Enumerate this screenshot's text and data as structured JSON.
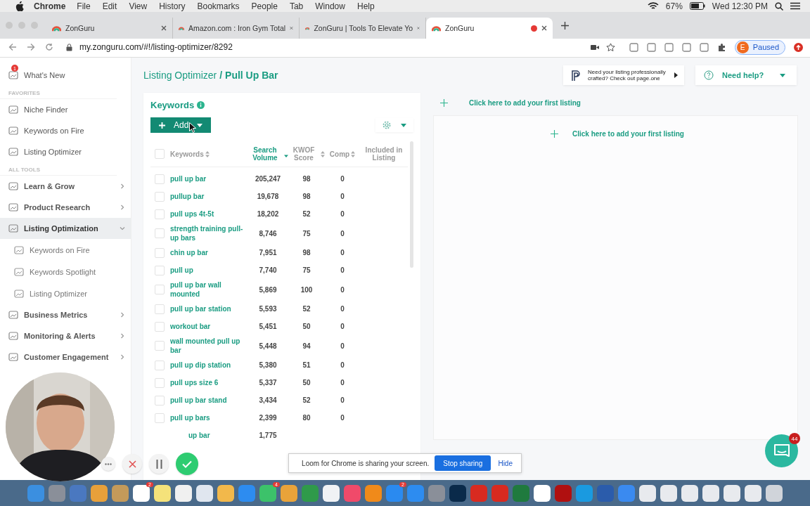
{
  "menu_bar": {
    "app": "Chrome",
    "menus": [
      "File",
      "Edit",
      "View",
      "History",
      "Bookmarks",
      "People",
      "Tab",
      "Window",
      "Help"
    ],
    "battery": "67%",
    "clock": "Wed 12:30 PM"
  },
  "browser_tabs": [
    {
      "title": "ZonGuru",
      "selected": false,
      "recording": false
    },
    {
      "title": "Amazon.com : Iron Gym Total",
      "selected": false,
      "recording": false
    },
    {
      "title": "ZonGuru | Tools To Elevate Yo",
      "selected": false,
      "recording": false
    },
    {
      "title": "ZonGuru",
      "selected": true,
      "recording": true
    }
  ],
  "address_bar": {
    "url": "my.zonguru.com/#!/listing-optimizer/8292",
    "profile_initial": "E",
    "profile_status": "Paused"
  },
  "sidebar": {
    "items": [
      {
        "kind": "item",
        "label": "What's New",
        "badge": "1",
        "selected": false
      },
      {
        "kind": "section",
        "label": "FAVORITES"
      },
      {
        "kind": "item",
        "label": "Niche Finder",
        "selected": false
      },
      {
        "kind": "item",
        "label": "Keywords on Fire",
        "selected": false
      },
      {
        "kind": "item",
        "label": "Listing Optimizer",
        "selected": false
      },
      {
        "kind": "section",
        "label": "ALL TOOLS"
      },
      {
        "kind": "group",
        "label": "Learn & Grow",
        "expanded": false,
        "selected": false
      },
      {
        "kind": "group",
        "label": "Product Research",
        "expanded": false,
        "selected": false
      },
      {
        "kind": "group",
        "label": "Listing Optimization",
        "expanded": true,
        "selected": true,
        "children": [
          {
            "label": "Keywords on Fire",
            "selected": false
          },
          {
            "label": "Keywords Spotlight",
            "selected": false
          },
          {
            "label": "Listing Optimizer",
            "selected": false
          }
        ]
      },
      {
        "kind": "group",
        "label": "Business Metrics",
        "expanded": false,
        "selected": false
      },
      {
        "kind": "group",
        "label": "Monitoring & Alerts",
        "expanded": false,
        "selected": false
      },
      {
        "kind": "group",
        "label": "Customer Engagement",
        "expanded": false,
        "selected": false
      }
    ]
  },
  "breadcrumb": {
    "parent": "Listing Optimizer",
    "separator": "/",
    "current": "Pull Up Bar"
  },
  "promo": {
    "text": "Need your listing professionally crafted? Check out page.one"
  },
  "help": {
    "label": "Need help?"
  },
  "keywords": {
    "title": "Keywords",
    "add_button": "Add",
    "select_all": {
      "checked": false
    },
    "columns": [
      {
        "label": "Keywords",
        "sortable": true,
        "sorted": false
      },
      {
        "label": "Search Volume",
        "sortable": true,
        "sorted": true
      },
      {
        "label": "KWOF Score",
        "sortable": true,
        "sorted": false
      },
      {
        "label": "Comp",
        "sortable": true,
        "sorted": false
      },
      {
        "label": "Included in Listing",
        "sortable": false,
        "sorted": false
      }
    ],
    "rows": [
      {
        "keyword": "pull up bar",
        "volume": "205,247",
        "kwof": "98",
        "comp": "0",
        "checked": false
      },
      {
        "keyword": "pullup bar",
        "volume": "19,678",
        "kwof": "98",
        "comp": "0",
        "checked": false
      },
      {
        "keyword": "pull ups 4t-5t",
        "volume": "18,202",
        "kwof": "52",
        "comp": "0",
        "checked": false
      },
      {
        "keyword": "strength training pull-up bars",
        "volume": "8,746",
        "kwof": "75",
        "comp": "0",
        "checked": false
      },
      {
        "keyword": "chin up bar",
        "volume": "7,951",
        "kwof": "98",
        "comp": "0",
        "checked": false
      },
      {
        "keyword": "pull up",
        "volume": "7,740",
        "kwof": "75",
        "comp": "0",
        "checked": false
      },
      {
        "keyword": "pull up bar wall mounted",
        "volume": "5,869",
        "kwof": "100",
        "comp": "0",
        "checked": false
      },
      {
        "keyword": "pull up bar station",
        "volume": "5,593",
        "kwof": "52",
        "comp": "0",
        "checked": false
      },
      {
        "keyword": "workout bar",
        "volume": "5,451",
        "kwof": "50",
        "comp": "0",
        "checked": false
      },
      {
        "keyword": "wall mounted pull up bar",
        "volume": "5,448",
        "kwof": "94",
        "comp": "0",
        "checked": false
      },
      {
        "keyword": "pull up dip station",
        "volume": "5,380",
        "kwof": "51",
        "comp": "0",
        "checked": false
      },
      {
        "keyword": "pull ups size 6",
        "volume": "5,337",
        "kwof": "50",
        "comp": "0",
        "checked": false
      },
      {
        "keyword": "pull up bar stand",
        "volume": "3,434",
        "kwof": "52",
        "comp": "0",
        "checked": false
      },
      {
        "keyword": "pull up bars",
        "volume": "2,399",
        "kwof": "80",
        "comp": "0",
        "checked": false
      },
      {
        "keyword": "up bar",
        "volume": "1,775"
      }
    ]
  },
  "listing": {
    "add_link": "Click here to add your first listing",
    "card_add_link": "Click here to add your first listing"
  },
  "loom": {
    "message": "Loom for Chrome is sharing your screen.",
    "stop": "Stop sharing",
    "hide": "Hide"
  },
  "chat": {
    "badge": "44"
  },
  "dock": [
    {
      "color": "#3b8fe0"
    },
    {
      "color": "#8a8f99"
    },
    {
      "color": "#4a78c0"
    },
    {
      "color": "#e8a03a"
    },
    {
      "color": "#c49a5a"
    },
    {
      "color": "#ffffff",
      "badge": "2"
    },
    {
      "color": "#f5e27a"
    },
    {
      "color": "#f0f0f0"
    },
    {
      "color": "#e0e6ef"
    },
    {
      "color": "#f2b84b"
    },
    {
      "color": "#2d8cf0"
    },
    {
      "color": "#3cc26a",
      "badge": "4"
    },
    {
      "color": "#e9a33a"
    },
    {
      "color": "#2f9a4a"
    },
    {
      "color": "#f0f2f5"
    },
    {
      "color": "#f04a6a"
    },
    {
      "color": "#f08a1a"
    },
    {
      "color": "#2a8af0",
      "badge": "2"
    },
    {
      "color": "#2d8cf0"
    },
    {
      "color": "#8a8f99"
    },
    {
      "color": "#0a2a4a"
    },
    {
      "color": "#d82a20"
    },
    {
      "color": "#d82a20"
    },
    {
      "color": "#1f7a3e"
    },
    {
      "color": "#ffffff"
    },
    {
      "color": "#b01010"
    },
    {
      "color": "#1a9ae0"
    },
    {
      "color": "#2b5cab"
    },
    {
      "color": "#3a8af0"
    },
    {
      "color": "#e8eaee"
    },
    {
      "color": "#e8eaee"
    },
    {
      "color": "#e8eaee"
    },
    {
      "color": "#e8eaee"
    },
    {
      "color": "#e8eaee"
    },
    {
      "color": "#e8eaee"
    },
    {
      "color": "#d0d4da"
    }
  ]
}
